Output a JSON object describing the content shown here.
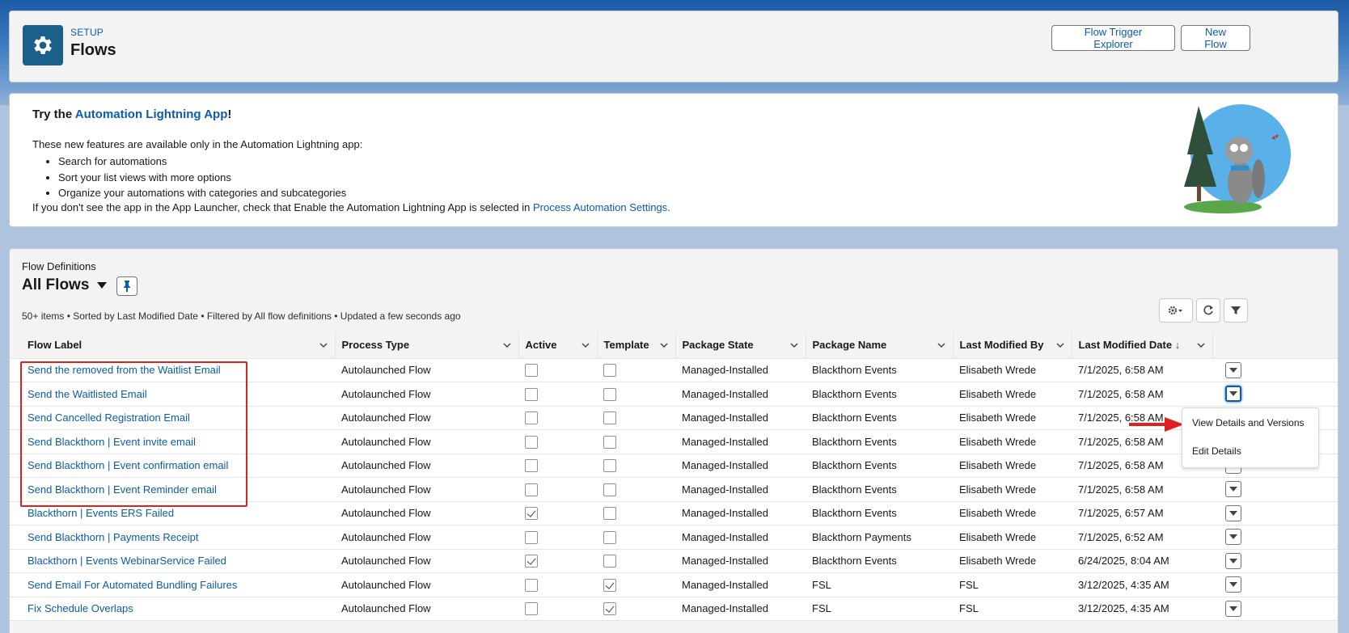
{
  "header": {
    "setup_label": "SETUP",
    "title": "Flows",
    "buttons": {
      "trigger_explorer": "Flow Trigger Explorer",
      "new_flow": "New Flow"
    }
  },
  "promo": {
    "title_prefix": "Try the ",
    "title_link": "Automation Lightning App",
    "title_suffix": "!",
    "intro": "These new features are available only in the Automation Lightning app:",
    "features": [
      "Search for automations",
      "Sort your list views with more options",
      "Organize your automations with categories and subcategories"
    ],
    "footer_text": "If you don't see the app in the App Launcher, check that Enable the Automation Lightning App is selected in ",
    "footer_link": "Process Automation Settings."
  },
  "list": {
    "object_label": "Flow Definitions",
    "view_name": "All Flows",
    "meta": "50+ items • Sorted by Last Modified Date • Filtered by All flow definitions • Updated a few seconds ago",
    "columns": [
      "Flow Label",
      "Process Type",
      "Active",
      "Template",
      "Package State",
      "Package Name",
      "Last Modified By",
      "Last Modified Date"
    ],
    "sort_indicator": "↓",
    "rows": [
      {
        "label": "Send the removed from the Waitlist Email",
        "process_type": "Autolaunched Flow",
        "active": false,
        "template": false,
        "package_state": "Managed-Installed",
        "package_name": "Blackthorn Events",
        "modified_by": "Elisabeth Wrede",
        "modified_date": "7/1/2025, 6:58 AM"
      },
      {
        "label": "Send the Waitlisted Email",
        "process_type": "Autolaunched Flow",
        "active": false,
        "template": false,
        "package_state": "Managed-Installed",
        "package_name": "Blackthorn Events",
        "modified_by": "Elisabeth Wrede",
        "modified_date": "7/1/2025, 6:58 AM"
      },
      {
        "label": "Send Cancelled Registration Email",
        "process_type": "Autolaunched Flow",
        "active": false,
        "template": false,
        "package_state": "Managed-Installed",
        "package_name": "Blackthorn Events",
        "modified_by": "Elisabeth Wrede",
        "modified_date": "7/1/2025, 6:58 AM"
      },
      {
        "label": "Send Blackthorn | Event invite email",
        "process_type": "Autolaunched Flow",
        "active": false,
        "template": false,
        "package_state": "Managed-Installed",
        "package_name": "Blackthorn Events",
        "modified_by": "Elisabeth Wrede",
        "modified_date": "7/1/2025, 6:58 AM"
      },
      {
        "label": "Send Blackthorn | Event confirmation email",
        "process_type": "Autolaunched Flow",
        "active": false,
        "template": false,
        "package_state": "Managed-Installed",
        "package_name": "Blackthorn Events",
        "modified_by": "Elisabeth Wrede",
        "modified_date": "7/1/2025, 6:58 AM"
      },
      {
        "label": "Send Blackthorn | Event Reminder email",
        "process_type": "Autolaunched Flow",
        "active": false,
        "template": false,
        "package_state": "Managed-Installed",
        "package_name": "Blackthorn Events",
        "modified_by": "Elisabeth Wrede",
        "modified_date": "7/1/2025, 6:58 AM"
      },
      {
        "label": "Blackthorn | Events ERS Failed",
        "process_type": "Autolaunched Flow",
        "active": true,
        "template": false,
        "package_state": "Managed-Installed",
        "package_name": "Blackthorn Events",
        "modified_by": "Elisabeth Wrede",
        "modified_date": "7/1/2025, 6:57 AM"
      },
      {
        "label": "Send Blackthorn | Payments Receipt",
        "process_type": "Autolaunched Flow",
        "active": false,
        "template": false,
        "package_state": "Managed-Installed",
        "package_name": "Blackthorn Payments",
        "modified_by": "Elisabeth Wrede",
        "modified_date": "7/1/2025, 6:52 AM"
      },
      {
        "label": "Blackthorn | Events WebinarService Failed",
        "process_type": "Autolaunched Flow",
        "active": true,
        "template": false,
        "package_state": "Managed-Installed",
        "package_name": "Blackthorn Events",
        "modified_by": "Elisabeth Wrede",
        "modified_date": "6/24/2025, 8:04 AM"
      },
      {
        "label": "Send Email For Automated Bundling Failures",
        "process_type": "Autolaunched Flow",
        "active": false,
        "template": true,
        "package_state": "Managed-Installed",
        "package_name": "FSL",
        "modified_by": "FSL",
        "modified_date": "3/12/2025, 4:35 AM"
      },
      {
        "label": "Fix Schedule Overlaps",
        "process_type": "Autolaunched Flow",
        "active": false,
        "template": true,
        "package_state": "Managed-Installed",
        "package_name": "FSL",
        "modified_by": "FSL",
        "modified_date": "3/12/2025, 4:35 AM"
      }
    ]
  },
  "row_menu": {
    "items": [
      "View Details and Versions",
      "Edit Details"
    ]
  },
  "colors": {
    "brand_link": "#0b5cab",
    "highlight_red": "#e0201c",
    "header_icon": "#1b5f8a"
  },
  "icons": [
    "gear-icon",
    "pin-icon",
    "settings-gear-icon",
    "refresh-icon",
    "filter-icon",
    "chevron-down-icon",
    "arrow-right-icon"
  ]
}
